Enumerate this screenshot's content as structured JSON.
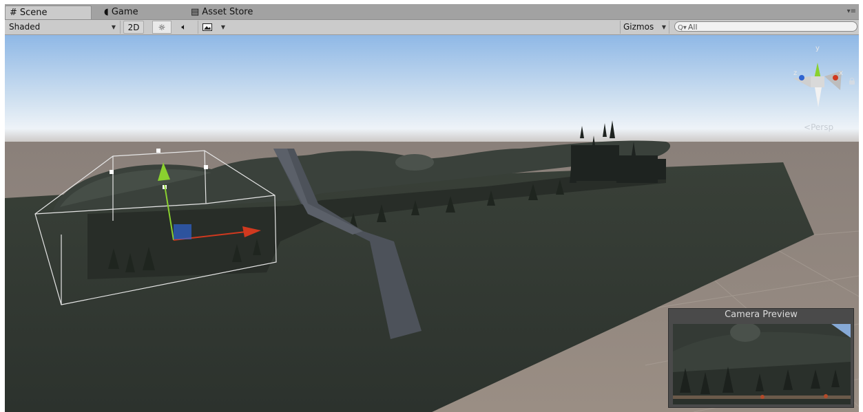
{
  "tabs": [
    {
      "label": "Scene",
      "icon": "scene-grid-icon",
      "active": true
    },
    {
      "label": "Game",
      "icon": "game-pacman-icon",
      "active": false
    },
    {
      "label": "Asset Store",
      "icon": "asset-store-bag-icon",
      "active": false
    }
  ],
  "toolbar": {
    "shading_mode": "Shaded",
    "mode_2d": "2D",
    "gizmos": "Gizmos",
    "search_value": "All"
  },
  "scene_gizmo": {
    "projection": "Persp",
    "axes": {
      "y": "y",
      "z": "z",
      "x": "x"
    }
  },
  "camera_preview": {
    "title": "Camera Preview"
  },
  "colors": {
    "terrain": "#303631",
    "ground": "#7e746c",
    "sky_top": "#8fb8e6",
    "x_axis": "#d0391f",
    "y_axis": "#8ad12f",
    "z_axis": "#2f64d0"
  }
}
